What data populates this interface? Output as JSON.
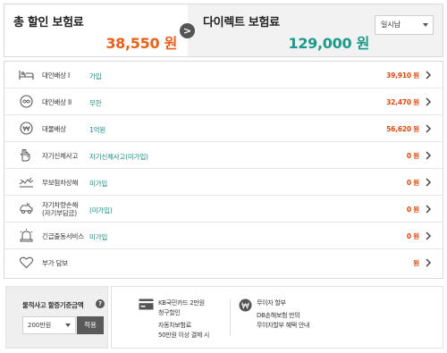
{
  "total_discount": {
    "title": "총 할인 보험료",
    "amount": "38,550",
    "unit": "원"
  },
  "compare_arrow": ">",
  "direct": {
    "title": "다이렉트 보험료",
    "amount": "129,000",
    "unit": "원"
  },
  "payment_select": {
    "value": "일시납"
  },
  "coverages": [
    {
      "name": "대인배상 I",
      "name2": "",
      "desc": "가입",
      "price": "39,910 원",
      "icon": "car-bed-icon"
    },
    {
      "name": "대인배상 II",
      "name2": "",
      "desc": "무한",
      "price": "32,470 원",
      "icon": "infinity-circle-icon"
    },
    {
      "name": "대물배상",
      "name2": "",
      "desc": "1억원",
      "price": "56,620 원",
      "icon": "won-coin-icon"
    },
    {
      "name": "자기신체사고",
      "name2": "",
      "desc": "자기신체사고(미가입)",
      "price": "0 원",
      "icon": "hand-icon"
    },
    {
      "name": "무보험차상해",
      "name2": "",
      "desc": "미가입",
      "price": "0 원",
      "icon": "crash-icon"
    },
    {
      "name": "자기차량손해",
      "name2": "(자기부담금)",
      "desc": "(미가입)",
      "price": "0 원",
      "icon": "car-damage-icon"
    },
    {
      "name": "긴급출동서비스",
      "name2": "",
      "desc": "미가입",
      "price": "0 원",
      "icon": "emergency-light-icon"
    },
    {
      "name": "부가 담보",
      "name2": "",
      "desc": "",
      "price": "원",
      "icon": "heart-icon"
    }
  ],
  "deductible": {
    "label": "물적사고 할증기준금액",
    "help": "?",
    "select_value": "200만원",
    "apply_label": "적용"
  },
  "benefits": [
    {
      "icon": "card-icon",
      "lines": [
        "KB국민카드 2만원",
        "청구할인",
        "자동차보험료",
        "50만원 이상 결제 시"
      ]
    },
    {
      "icon": "won-circle-icon",
      "lines": [
        "무이자 할부",
        "DB손해보험 만의",
        "무이자할부 혜택 안내"
      ]
    }
  ],
  "colors": {
    "discount": "#e8601c",
    "direct": "#1a9a8c",
    "price": "#d9480f",
    "desc": "#1a8c7e"
  }
}
